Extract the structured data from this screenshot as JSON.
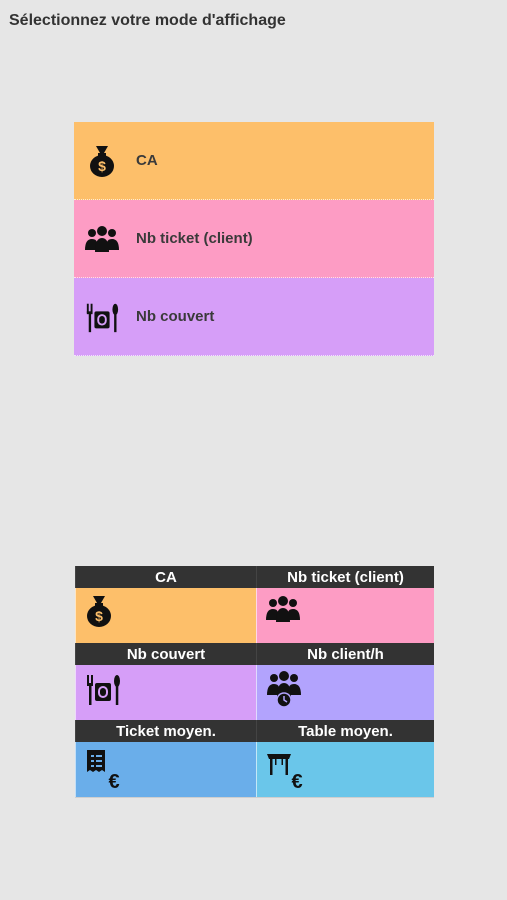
{
  "page_title": "Sélectionnez votre mode d'affichage",
  "modes": [
    {
      "label": "CA",
      "icon": "money-bag-icon",
      "color": "#fdbf6a"
    },
    {
      "label": "Nb ticket (client)",
      "icon": "group-icon",
      "color": "#fd9cc4"
    },
    {
      "label": "Nb couvert",
      "icon": "dining-icon",
      "color": "#d69ef8"
    }
  ],
  "tiles": [
    {
      "label": "CA",
      "icon": "money-bag-icon",
      "color": "#fdbf6a"
    },
    {
      "label": "Nb ticket (client)",
      "icon": "group-icon",
      "color": "#fd9cc4"
    },
    {
      "label": "Nb couvert",
      "icon": "dining-icon",
      "color": "#d69ef8"
    },
    {
      "label": "Nb client/h",
      "icon": "group-clock-icon",
      "color": "#b2a3fd"
    },
    {
      "label": "Ticket moyen.",
      "icon": "receipt-euro-icon",
      "color": "#6aaeea"
    },
    {
      "label": "Table moyen.",
      "icon": "table-euro-icon",
      "color": "#6ac6ea"
    }
  ]
}
